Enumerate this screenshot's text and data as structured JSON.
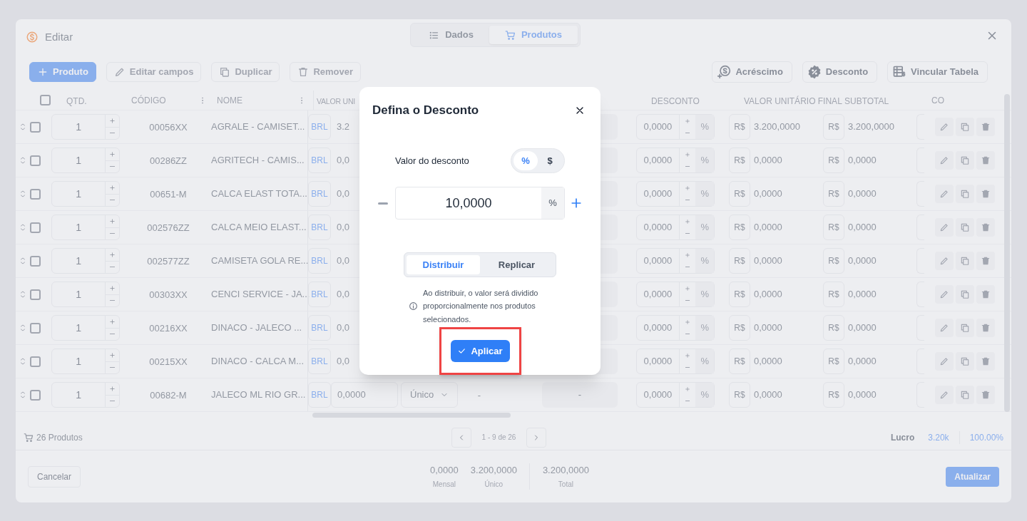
{
  "window": {
    "title": "Editar",
    "tabs": [
      {
        "label": "Dados",
        "selected": false
      },
      {
        "label": "Produtos",
        "selected": true
      }
    ]
  },
  "toolbar": {
    "left": [
      {
        "label": "Produto",
        "kind": "primary",
        "disabled": false
      },
      {
        "label": "Editar campos",
        "kind": "outline",
        "disabled": true
      },
      {
        "label": "Duplicar",
        "kind": "outline",
        "disabled": true
      },
      {
        "label": "Remover",
        "kind": "outline",
        "disabled": true
      }
    ],
    "right": [
      {
        "label": "Acréscimo"
      },
      {
        "label": "Desconto"
      },
      {
        "label": "Vincular Tabela"
      }
    ]
  },
  "table": {
    "select_all_checked": false,
    "columns": {
      "qty": "QTD.",
      "code": "CÓDIGO",
      "name": "NOME",
      "unit_value": "VALOR UNI",
      "discount": "DESCONTO",
      "final_value": "VALOR UNITÁRIO FINAL",
      "subtotal": "SUBTOTAL",
      "column_10": "CO"
    },
    "rows": [
      {
        "checked": false,
        "qty": "1",
        "code": "00056XX",
        "name": "AGRALE - CAMISET...",
        "currency": "BRL",
        "unit_value": "3.2",
        "discount": "0,0000",
        "discount_unit": "%",
        "final_currency": "R$",
        "final_value": "3.200,0000",
        "subtotal_currency": "R$",
        "subtotal": "3.200,0000"
      },
      {
        "checked": false,
        "qty": "1",
        "code": "00286ZZ",
        "name": "AGRITECH - CAMIS...",
        "currency": "BRL",
        "unit_value": "0,0",
        "discount": "0,0000",
        "discount_unit": "%",
        "final_currency": "R$",
        "final_value": "0,0000",
        "subtotal_currency": "R$",
        "subtotal": "0,0000"
      },
      {
        "checked": false,
        "qty": "1",
        "code": "00651-M",
        "name": "CALCA ELAST TOTA...",
        "currency": "BRL",
        "unit_value": "0,0",
        "discount": "0,0000",
        "discount_unit": "%",
        "final_currency": "R$",
        "final_value": "0,0000",
        "subtotal_currency": "R$",
        "subtotal": "0,0000"
      },
      {
        "checked": false,
        "qty": "1",
        "code": "002576ZZ",
        "name": "CALCA MEIO ELAST...",
        "currency": "BRL",
        "unit_value": "0,0",
        "discount": "0,0000",
        "discount_unit": "%",
        "final_currency": "R$",
        "final_value": "0,0000",
        "subtotal_currency": "R$",
        "subtotal": "0,0000"
      },
      {
        "checked": false,
        "qty": "1",
        "code": "002577ZZ",
        "name": "CAMISETA GOLA RE...",
        "currency": "BRL",
        "unit_value": "0,0",
        "discount": "0,0000",
        "discount_unit": "%",
        "final_currency": "R$",
        "final_value": "0,0000",
        "subtotal_currency": "R$",
        "subtotal": "0,0000"
      },
      {
        "checked": false,
        "qty": "1",
        "code": "00303XX",
        "name": "CENCI SERVICE - JA...",
        "currency": "BRL",
        "unit_value": "0,0",
        "discount": "0,0000",
        "discount_unit": "%",
        "final_currency": "R$",
        "final_value": "0,0000",
        "subtotal_currency": "R$",
        "subtotal": "0,0000"
      },
      {
        "checked": false,
        "qty": "1",
        "code": "00216XX",
        "name": "DINACO - JALECO ...",
        "currency": "BRL",
        "unit_value": "0,0",
        "discount": "0,0000",
        "discount_unit": "%",
        "final_currency": "R$",
        "final_value": "0,0000",
        "subtotal_currency": "R$",
        "subtotal": "0,0000"
      },
      {
        "checked": false,
        "qty": "1",
        "code": "00215XX",
        "name": "DINACO - CALCA M...",
        "currency": "BRL",
        "unit_value": "0,0",
        "discount": "0,0000",
        "discount_unit": "%",
        "final_currency": "R$",
        "final_value": "0,0000",
        "subtotal_currency": "R$",
        "subtotal": "0,0000"
      },
      {
        "checked": false,
        "qty": "1",
        "code": "00682-M",
        "name": "JALECO ML RIO GR...",
        "currency": "BRL",
        "unit_value": "0,0000",
        "type": "Único",
        "column_6": "-",
        "column_7": "-",
        "discount": "0,0000",
        "discount_unit": "%",
        "final_currency": "R$",
        "final_value": "0,0000",
        "subtotal_currency": "R$",
        "subtotal": "0,0000"
      }
    ]
  },
  "footer": {
    "count": "26 Produtos",
    "pagination": "1 - 9 de 26",
    "profit_label": "Lucro",
    "profit_value": "3.20k",
    "profit_percent": "100.00%"
  },
  "bottom_bar": {
    "cancel": "Cancelar",
    "totals": [
      {
        "value": "0,0000",
        "label": "Mensal"
      },
      {
        "value": "3.200,0000",
        "label": "Único"
      },
      {
        "value": "3.200,0000",
        "label": "Total"
      }
    ],
    "submit": "Atualizar"
  },
  "dialog": {
    "title": "Defina o Desconto",
    "value_label": "Valor do desconto",
    "unit_toggle": [
      {
        "label": "%",
        "selected": true
      },
      {
        "label": "$",
        "selected": false
      }
    ],
    "value": "10,0000",
    "value_suffix": "%",
    "modes": [
      {
        "label": "Distribuir",
        "selected": true
      },
      {
        "label": "Replicar",
        "selected": false
      }
    ],
    "note": "Ao distribuir, o valor será dividido proporcionalmente nos produtos selecionados.",
    "apply": {
      "label": "Aplicar",
      "highlighted": true
    }
  }
}
